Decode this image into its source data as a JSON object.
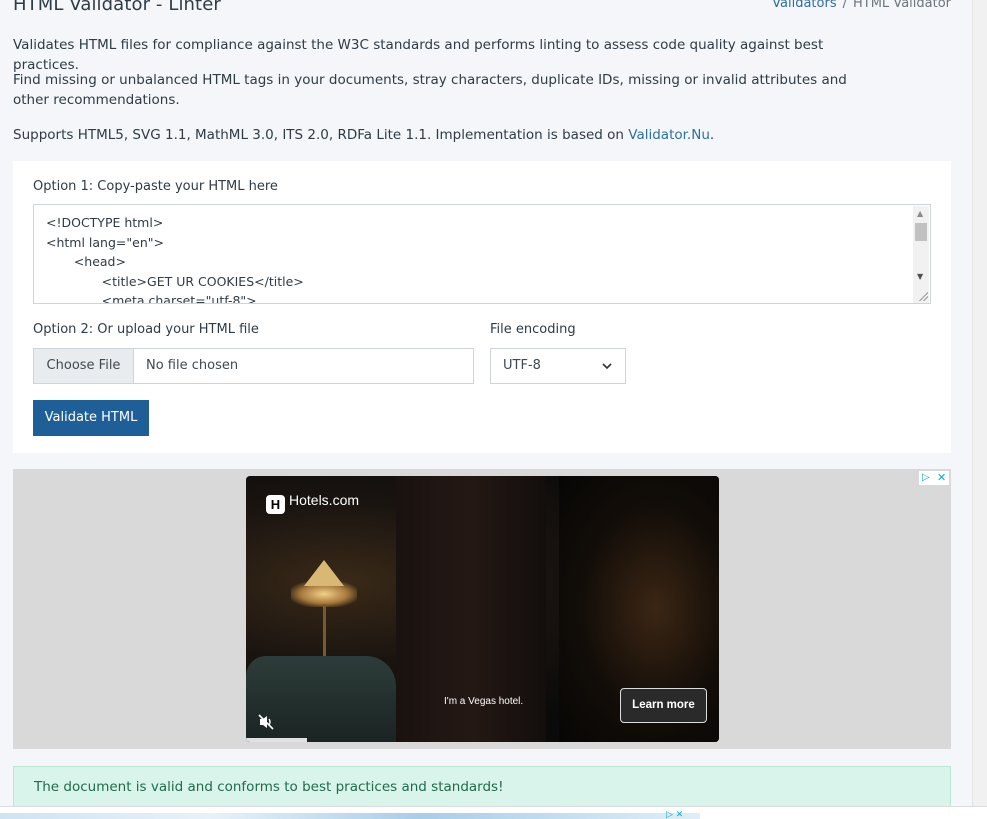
{
  "header": {
    "title": "HTML Validator - Linter",
    "breadcrumb": {
      "link": "Validators",
      "separator": "/",
      "current": "HTML Validator"
    }
  },
  "intro": {
    "p1": "Validates HTML files for compliance against the W3C standards and performs linting to assess code quality against best practices.",
    "p2": "Find missing or unbalanced HTML tags in your documents, stray characters, duplicate IDs, missing or invalid attributes and other recommendations.",
    "p3_prefix": "Supports HTML5, SVG 1.1, MathML 3.0, ITS 2.0, RDFa Lite 1.1. Implementation is based on ",
    "p3_link": "Validator.Nu",
    "p3_suffix": "."
  },
  "form": {
    "option1_label": "Option 1: Copy-paste your HTML here",
    "code": "<!DOCTYPE html>\n<html lang=\"en\">\n       <head>\n              <title>GET UR COOKIES</title>\n              <meta charset=\"utf-8\">",
    "option2_label": "Option 2: Or upload your HTML file",
    "choose_file": "Choose File",
    "file_status": "No file chosen",
    "encoding_label": "File encoding",
    "encoding_value": "UTF-8",
    "validate_button": "Validate HTML"
  },
  "ad": {
    "brand": "Hotels.com",
    "brand_mark": "H",
    "caption": "I'm a Vegas hotel.",
    "cta": "Learn more",
    "progress": 0.13
  },
  "result": {
    "message": "The document is valid and conforms to best practices and standards!"
  },
  "icons": {
    "mute": "mute-icon",
    "chevron": "chevron-down-icon",
    "adchoices": "adchoices-icon",
    "close": "close-icon"
  },
  "colors": {
    "primary": "#1f5f97",
    "link": "#2e6f9e",
    "success_bg": "#d9f4ea",
    "success_text": "#1e6b4e"
  }
}
